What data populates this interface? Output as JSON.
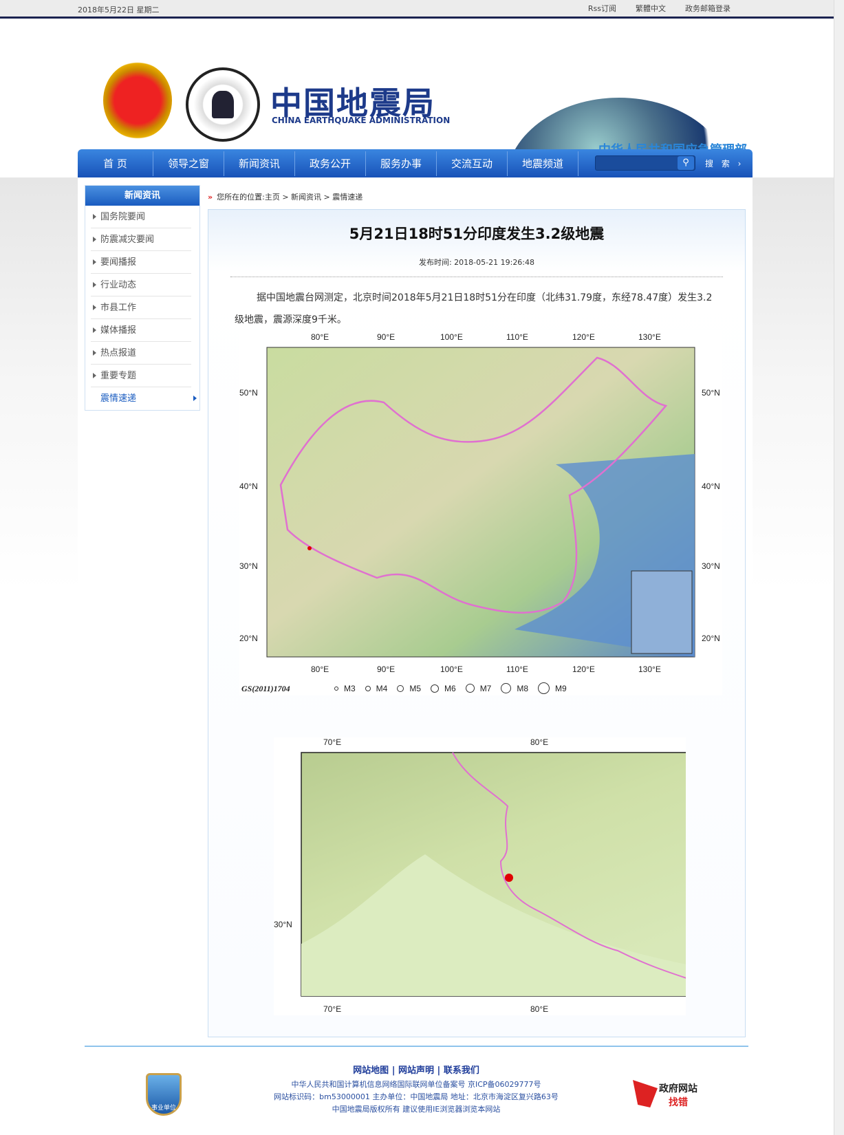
{
  "topbar": {
    "date": "2018年5月22日  星期二",
    "links": [
      "Rss订阅",
      "繁體中文",
      "政务邮箱登录"
    ]
  },
  "header": {
    "logo_cn": "中国地震局",
    "logo_en": "CHINA EARTHQUAKE ADMINISTRATION",
    "ministry": "中华人民共和国应急管理部",
    "seal_text": "CHINA EARTHQUAKE ADMINISTRATION 中国地震局"
  },
  "nav": {
    "items": [
      "首  页",
      "领导之窗",
      "新闻资讯",
      "政务公开",
      "服务办事",
      "交流互动",
      "地震频道"
    ],
    "search_value": "",
    "search_label": "搜  索 ›",
    "search_icon": "magnifier-icon"
  },
  "sidebar": {
    "title": "新闻资讯",
    "items": [
      "国务院要闻",
      "防震减灾要闻",
      "要闻播报",
      "行业动态",
      "市县工作",
      "媒体播报",
      "热点报道",
      "重要专题",
      "震情速递"
    ],
    "active": "震情速递"
  },
  "breadcrumb": {
    "prefix": "您所在的位置:",
    "path": "主页 > 新闻资讯 > 震情速递"
  },
  "article": {
    "title": "5月21日18时51分印度发生3.2级地震",
    "publish": "发布时间: 2018-05-21 19:26:48",
    "body": "据中国地震台网测定，北京时间2018年5月21日18时51分在印度（北纬31.79度，东经78.47度）发生3.2级地震，震源深度9千米。"
  },
  "map1": {
    "lon_labels": [
      "80°E",
      "90°E",
      "100°E",
      "110°E",
      "120°E",
      "130°E"
    ],
    "lat_labels": [
      "50°N",
      "40°N",
      "30°N",
      "20°N"
    ],
    "code": "GS(2011)1704",
    "legend": [
      "M3",
      "M4",
      "M5",
      "M6",
      "M7",
      "M8",
      "M9"
    ],
    "epicenter": {
      "lat": 31.79,
      "lon": 78.47
    },
    "epicenter_color": "#e00000",
    "border_color": "#e070d0"
  },
  "map2": {
    "lon_labels": [
      "70°E",
      "80°E"
    ],
    "lat_labels": [
      "30°N"
    ],
    "epicenter": {
      "lat": 31.79,
      "lon": 78.47
    }
  },
  "footer": {
    "links": [
      "网站地图",
      "网站声明",
      "联系我们"
    ],
    "lines": [
      "中华人民共和国计算机信息网络国际联网单位备案号  京ICP备06029777号",
      "网站标识码：bm53000001  主办单位：中国地震局  地址：北京市海淀区复兴路63号",
      "中国地震局版权所有  建议使用IE浏览器浏览本网站"
    ],
    "badge": "事业单位",
    "gov_line1": "政府网站",
    "gov_line2": "找错"
  }
}
